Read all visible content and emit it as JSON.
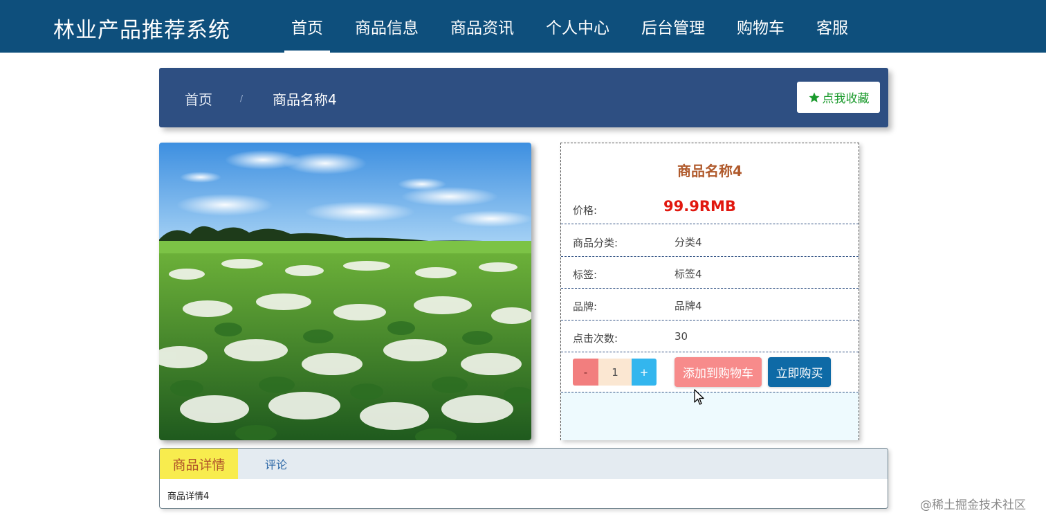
{
  "header": {
    "brand": "林业产品推荐系统",
    "nav": [
      "首页",
      "商品信息",
      "商品资讯",
      "个人中心",
      "后台管理",
      "购物车",
      "客服"
    ],
    "active_index": 0
  },
  "breadcrumb": {
    "home": "首页",
    "separator": "/",
    "current": "商品名称4",
    "favorite_label": "点我收藏"
  },
  "product": {
    "name": "商品名称4",
    "price_label": "价格:",
    "price": "99.9RMB",
    "fields": [
      {
        "label": "商品分类:",
        "value": "分类4"
      },
      {
        "label": "标签:",
        "value": "标签4"
      },
      {
        "label": "品牌:",
        "value": "品牌4"
      },
      {
        "label": "点击次数:",
        "value": "30"
      }
    ],
    "quantity": {
      "minus": "-",
      "value": "1",
      "plus": "+"
    },
    "add_to_cart": "添加到购物车",
    "buy_now": "立即购买"
  },
  "tabs": {
    "items": [
      "商品详情",
      "评论"
    ],
    "active_index": 0,
    "content": "商品详情4"
  },
  "watermark": "@稀土掘金技术社区",
  "colors": {
    "nav_bg": "#0e4f7c",
    "breadcrumb_bg": "#2e4f82",
    "price": "#e1180f",
    "title": "#b05a2c",
    "favorite": "#1a9a2c",
    "cart_button": "#f78b8b",
    "buy_button": "#0e6aa6",
    "active_tab": "#f8ec4e"
  }
}
